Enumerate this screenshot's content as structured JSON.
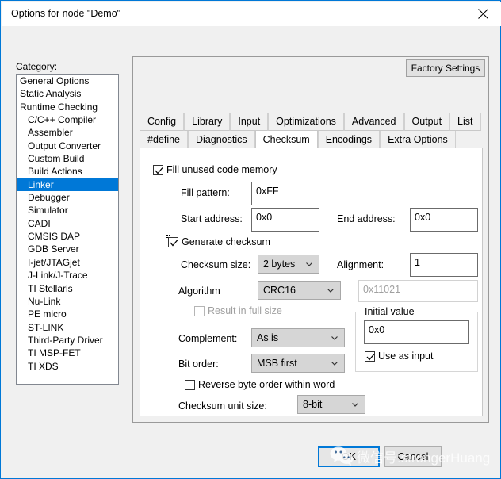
{
  "window": {
    "title": "Options for node \"Demo\"",
    "close_icon": "close-icon"
  },
  "sidebar": {
    "label": "Category:",
    "items": [
      {
        "label": "General Options",
        "indent": false,
        "selected": false
      },
      {
        "label": "Static Analysis",
        "indent": false,
        "selected": false
      },
      {
        "label": "Runtime Checking",
        "indent": false,
        "selected": false
      },
      {
        "label": "C/C++ Compiler",
        "indent": true,
        "selected": false
      },
      {
        "label": "Assembler",
        "indent": true,
        "selected": false
      },
      {
        "label": "Output Converter",
        "indent": true,
        "selected": false
      },
      {
        "label": "Custom Build",
        "indent": true,
        "selected": false
      },
      {
        "label": "Build Actions",
        "indent": true,
        "selected": false
      },
      {
        "label": "Linker",
        "indent": true,
        "selected": true
      },
      {
        "label": "Debugger",
        "indent": true,
        "selected": false
      },
      {
        "label": "Simulator",
        "indent": true,
        "selected": false
      },
      {
        "label": "CADI",
        "indent": true,
        "selected": false
      },
      {
        "label": "CMSIS DAP",
        "indent": true,
        "selected": false
      },
      {
        "label": "GDB Server",
        "indent": true,
        "selected": false
      },
      {
        "label": "I-jet/JTAGjet",
        "indent": true,
        "selected": false
      },
      {
        "label": "J-Link/J-Trace",
        "indent": true,
        "selected": false
      },
      {
        "label": "TI Stellaris",
        "indent": true,
        "selected": false
      },
      {
        "label": "Nu-Link",
        "indent": true,
        "selected": false
      },
      {
        "label": "PE micro",
        "indent": true,
        "selected": false
      },
      {
        "label": "ST-LINK",
        "indent": true,
        "selected": false
      },
      {
        "label": "Third-Party Driver",
        "indent": true,
        "selected": false
      },
      {
        "label": "TI MSP-FET",
        "indent": true,
        "selected": false
      },
      {
        "label": "TI XDS",
        "indent": true,
        "selected": false
      }
    ]
  },
  "toolbar": {
    "factory_settings_label": "Factory Settings"
  },
  "tabs": {
    "row1": [
      "Config",
      "Library",
      "Input",
      "Optimizations",
      "Advanced",
      "Output",
      "List"
    ],
    "row2": [
      "#define",
      "Diagnostics",
      "Checksum",
      "Encodings",
      "Extra Options"
    ],
    "active": "Checksum"
  },
  "checksum_page": {
    "fill_unused": {
      "label": "Fill unused code memory",
      "checked": true
    },
    "fill_pattern": {
      "label": "Fill pattern:",
      "value": "0xFF"
    },
    "start_address": {
      "label": "Start address:",
      "value": "0x0"
    },
    "end_address": {
      "label": "End address:",
      "value": "0x0"
    },
    "generate_checksum": {
      "label": "Generate checksum",
      "checked": true,
      "focused": true
    },
    "checksum_size": {
      "label": "Checksum size:",
      "value": "2 bytes"
    },
    "alignment": {
      "label": "Alignment:",
      "value": "1"
    },
    "algorithm": {
      "label": "Algorithm",
      "value": "CRC16"
    },
    "polynomial": {
      "value": "0x11021",
      "disabled": true
    },
    "result_full_size": {
      "label": "Result in full size",
      "checked": false,
      "disabled": true
    },
    "complement": {
      "label": "Complement:",
      "value": "As is"
    },
    "bit_order": {
      "label": "Bit order:",
      "value": "MSB first"
    },
    "reverse_byte_order": {
      "label": "Reverse byte order within word",
      "checked": false
    },
    "checksum_unit_size": {
      "label": "Checksum unit size:",
      "value": "8-bit"
    },
    "initial_value_group": {
      "title": "Initial value",
      "value": "0x0",
      "use_as_input": {
        "label": "Use as input",
        "checked": true
      }
    }
  },
  "footer": {
    "ok_label": "OK",
    "cancel_label": "Cancel"
  },
  "watermark": {
    "text": "微信号:strongerHuang"
  }
}
